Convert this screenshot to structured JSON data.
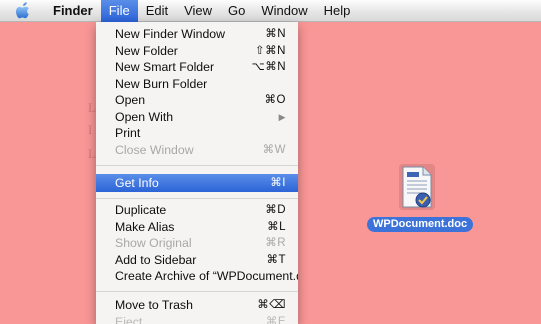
{
  "menubar": {
    "apple_icon": "apple-icon",
    "items": [
      "Finder",
      "File",
      "Edit",
      "View",
      "Go",
      "Window",
      "Help"
    ]
  },
  "file_menu": {
    "new_finder_window": {
      "label": "New Finder Window",
      "shortcut": "⌘N"
    },
    "new_folder": {
      "label": "New Folder",
      "shortcut": "⇧⌘N"
    },
    "new_smart_folder": {
      "label": "New Smart Folder",
      "shortcut": "⌥⌘N"
    },
    "new_burn_folder": {
      "label": "New Burn Folder",
      "shortcut": ""
    },
    "open": {
      "label": "Open",
      "shortcut": "⌘O"
    },
    "open_with": {
      "label": "Open With",
      "shortcut": "▶"
    },
    "print": {
      "label": "Print",
      "shortcut": ""
    },
    "close_window": {
      "label": "Close Window",
      "shortcut": "⌘W"
    },
    "get_info": {
      "label": "Get Info",
      "shortcut": "⌘I"
    },
    "duplicate": {
      "label": "Duplicate",
      "shortcut": "⌘D"
    },
    "make_alias": {
      "label": "Make Alias",
      "shortcut": "⌘L"
    },
    "show_original": {
      "label": "Show Original",
      "shortcut": "⌘R"
    },
    "add_to_sidebar": {
      "label": "Add to Sidebar",
      "shortcut": "⌘T"
    },
    "create_archive": {
      "label": "Create Archive of “WPDocument.doc”",
      "shortcut": ""
    },
    "move_to_trash": {
      "label": "Move to Trash",
      "shortcut": "⌘⌫"
    },
    "eject": {
      "label": "Eject",
      "shortcut": "⌘E"
    }
  },
  "desktop": {
    "file_name": "WPDocument.doc",
    "file_icon": "word-document-icon",
    "background_color": "#f99696",
    "accent_color": "#3d73d8"
  }
}
